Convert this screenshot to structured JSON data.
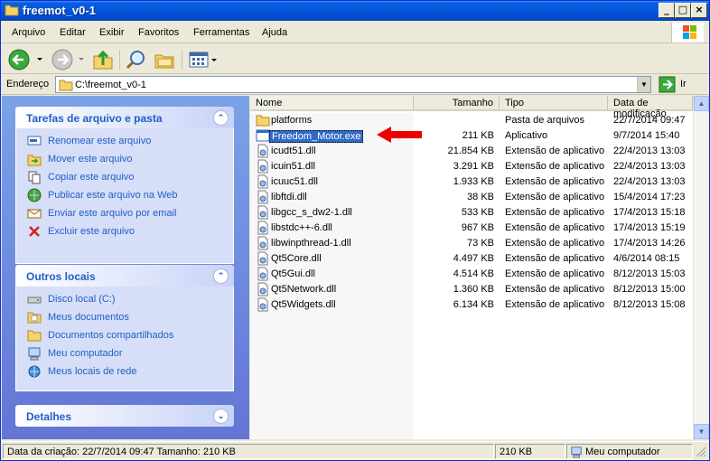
{
  "window": {
    "title": "freemot_v0-1"
  },
  "menu": [
    "Arquivo",
    "Editar",
    "Exibir",
    "Favoritos",
    "Ferramentas",
    "Ajuda"
  ],
  "address": {
    "label": "Endereço",
    "path": "C:\\freemot_v0-1",
    "go_label": "Ir"
  },
  "tasks_panel": {
    "title": "Tarefas de arquivo e pasta",
    "items": [
      {
        "label": "Renomear este arquivo",
        "icon": "rename-icon"
      },
      {
        "label": "Mover este arquivo",
        "icon": "move-icon"
      },
      {
        "label": "Copiar este arquivo",
        "icon": "copy-icon"
      },
      {
        "label": "Publicar este arquivo na Web",
        "icon": "publish-web-icon"
      },
      {
        "label": "Enviar este arquivo por email",
        "icon": "email-icon"
      },
      {
        "label": "Excluir este arquivo",
        "icon": "delete-icon"
      }
    ]
  },
  "places_panel": {
    "title": "Outros locais",
    "items": [
      {
        "label": "Disco local (C:)",
        "icon": "drive-icon"
      },
      {
        "label": "Meus documentos",
        "icon": "my-documents-icon"
      },
      {
        "label": "Documentos compartilhados",
        "icon": "shared-folder-icon"
      },
      {
        "label": "Meu computador",
        "icon": "my-computer-icon"
      },
      {
        "label": "Meus locais de rede",
        "icon": "network-icon"
      }
    ]
  },
  "details_panel": {
    "title": "Detalhes"
  },
  "columns": {
    "name": "Nome",
    "size": "Tamanho",
    "type": "Tipo",
    "modified": "Data de modificação"
  },
  "files": [
    {
      "name": "platforms",
      "size": "",
      "type": "Pasta de arquivos",
      "modified": "22/7/2014 09:47",
      "kind": "folder"
    },
    {
      "name": "Freedom_Motor.exe",
      "size": "211 KB",
      "type": "Aplicativo",
      "modified": "9/7/2014 15:40",
      "kind": "exe",
      "selected": true
    },
    {
      "name": "icudt51.dll",
      "size": "21.854 KB",
      "type": "Extensão de aplicativo",
      "modified": "22/4/2013 13:03",
      "kind": "dll"
    },
    {
      "name": "icuin51.dll",
      "size": "3.291 KB",
      "type": "Extensão de aplicativo",
      "modified": "22/4/2013 13:03",
      "kind": "dll"
    },
    {
      "name": "icuuc51.dll",
      "size": "1.933 KB",
      "type": "Extensão de aplicativo",
      "modified": "22/4/2013 13:03",
      "kind": "dll"
    },
    {
      "name": "libftdi.dll",
      "size": "38 KB",
      "type": "Extensão de aplicativo",
      "modified": "15/4/2014 17:23",
      "kind": "dll"
    },
    {
      "name": "libgcc_s_dw2-1.dll",
      "size": "533 KB",
      "type": "Extensão de aplicativo",
      "modified": "17/4/2013 15:18",
      "kind": "dll"
    },
    {
      "name": "libstdc++-6.dll",
      "size": "967 KB",
      "type": "Extensão de aplicativo",
      "modified": "17/4/2013 15:19",
      "kind": "dll"
    },
    {
      "name": "libwinpthread-1.dll",
      "size": "73 KB",
      "type": "Extensão de aplicativo",
      "modified": "17/4/2013 14:26",
      "kind": "dll"
    },
    {
      "name": "Qt5Core.dll",
      "size": "4.497 KB",
      "type": "Extensão de aplicativo",
      "modified": "4/6/2014 08:15",
      "kind": "dll"
    },
    {
      "name": "Qt5Gui.dll",
      "size": "4.514 KB",
      "type": "Extensão de aplicativo",
      "modified": "8/12/2013 15:03",
      "kind": "dll"
    },
    {
      "name": "Qt5Network.dll",
      "size": "1.360 KB",
      "type": "Extensão de aplicativo",
      "modified": "8/12/2013 15:00",
      "kind": "dll"
    },
    {
      "name": "Qt5Widgets.dll",
      "size": "6.134 KB",
      "type": "Extensão de aplicativo",
      "modified": "8/12/2013 15:08",
      "kind": "dll"
    }
  ],
  "status": {
    "info": "Data da criação: 22/7/2014 09:47 Tamanho: 210 KB",
    "size": "210 KB",
    "location": "Meu computador"
  },
  "colors": {
    "titlebar": "#0555dc",
    "task_link": "#215dc6",
    "selection": "#316ac5",
    "annotation_arrow": "#ee0000"
  }
}
